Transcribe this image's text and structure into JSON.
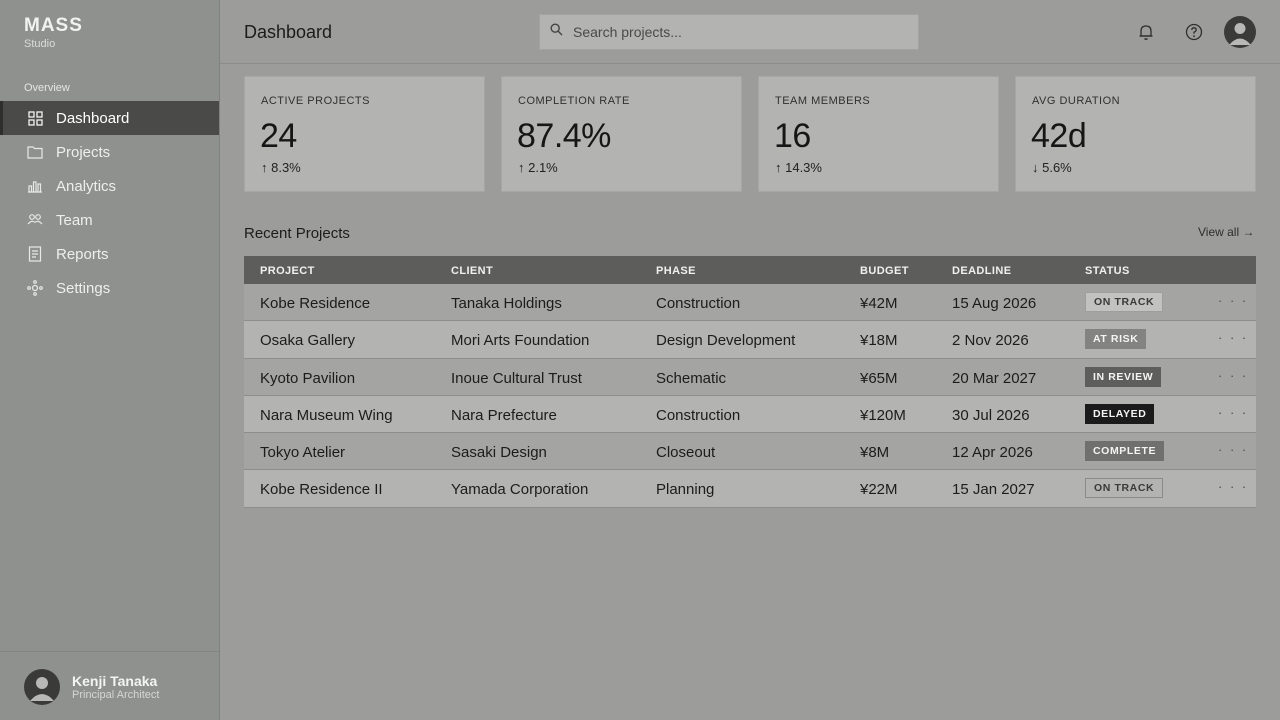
{
  "brand": {
    "name": "MASS",
    "subtitle": "Studio"
  },
  "sidebar": {
    "section_label": "Overview",
    "items": [
      {
        "label": "Dashboard",
        "icon": "grid-icon",
        "active": true
      },
      {
        "label": "Projects",
        "icon": "folder-icon"
      },
      {
        "label": "Analytics",
        "icon": "bar-chart-icon"
      },
      {
        "label": "Team",
        "icon": "team-icon"
      },
      {
        "label": "Reports",
        "icon": "document-icon"
      },
      {
        "label": "Settings",
        "icon": "settings-icon"
      }
    ],
    "user": {
      "name": "Kenji Tanaka",
      "role": "Principal Architect"
    }
  },
  "header": {
    "title": "Dashboard",
    "search_placeholder": "Search projects..."
  },
  "stats": [
    {
      "label": "ACTIVE PROJECTS",
      "value": "24",
      "delta": "↑ 8.3%"
    },
    {
      "label": "COMPLETION RATE",
      "value": "87.4%",
      "delta": "↑ 2.1%"
    },
    {
      "label": "TEAM MEMBERS",
      "value": "16",
      "delta": "↑ 14.3%"
    },
    {
      "label": "AVG DURATION",
      "value": "42d",
      "delta": "↓ 5.6%"
    }
  ],
  "recent": {
    "title": "Recent Projects",
    "view_all": "View all →",
    "columns": [
      "PROJECT",
      "CLIENT",
      "PHASE",
      "BUDGET",
      "DEADLINE",
      "STATUS"
    ],
    "rows": [
      {
        "project": "Kobe Residence",
        "client": "Tanaka Holdings",
        "phase": "Construction",
        "budget": "¥42M",
        "deadline": "15 Aug 2026",
        "status": "ON TRACK",
        "style": "on-track"
      },
      {
        "project": "Osaka Gallery",
        "client": "Mori Arts Foundation",
        "phase": "Design Development",
        "budget": "¥18M",
        "deadline": "2 Nov 2026",
        "status": "AT RISK",
        "style": "at-risk"
      },
      {
        "project": "Kyoto Pavilion",
        "client": "Inoue Cultural Trust",
        "phase": "Schematic",
        "budget": "¥65M",
        "deadline": "20 Mar 2027",
        "status": "IN REVIEW",
        "style": "in-review"
      },
      {
        "project": "Nara Museum Wing",
        "client": "Nara Prefecture",
        "phase": "Construction",
        "budget": "¥120M",
        "deadline": "30 Jul 2026",
        "status": "DELAYED",
        "style": "delayed"
      },
      {
        "project": "Tokyo Atelier",
        "client": "Sasaki Design",
        "phase": "Closeout",
        "budget": "¥8M",
        "deadline": "12 Apr 2026",
        "status": "COMPLETE",
        "style": "complete"
      },
      {
        "project": "Kobe Residence II",
        "client": "Yamada Corporation",
        "phase": "Planning",
        "budget": "¥22M",
        "deadline": "15 Jan 2027",
        "status": "ON TRACK",
        "style": "on-track-outline"
      }
    ],
    "more_label": "· · ·"
  }
}
